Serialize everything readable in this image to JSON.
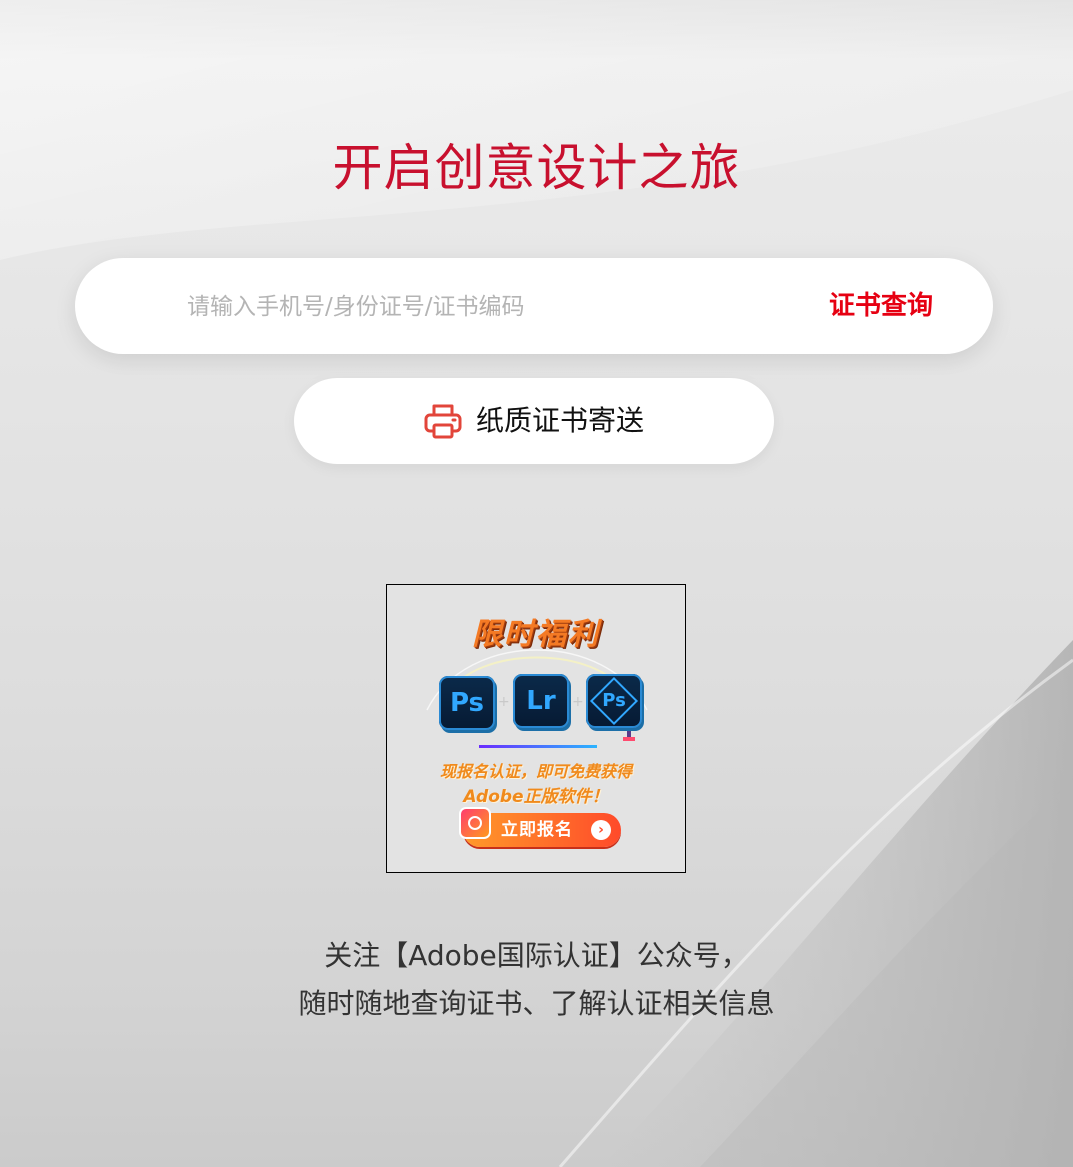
{
  "hero": {
    "title": "开启创意设计之旅"
  },
  "search": {
    "placeholder": "请输入手机号/身份证号/证书编码",
    "value": "",
    "button_label": "证书查询"
  },
  "paper_certificate": {
    "label": "纸质证书寄送",
    "icon": "printer-icon"
  },
  "promo": {
    "title": "限时福利",
    "apps": [
      "Ps",
      "Lr",
      "Ps"
    ],
    "line1": "现报名认证，即可免费获得",
    "line2": "Adobe正版软件！",
    "cta_label": "立即报名",
    "cta_arrow": "›",
    "colors": {
      "title": "#f47a24",
      "cta_start": "#ff9a2a",
      "cta_end": "#ff4a2a",
      "tile_text": "#31a8ff"
    }
  },
  "follow": {
    "line1": "关注【Adobe国际认证】公众号，",
    "line2": "随时随地查询证书、了解认证相关信息"
  },
  "colors": {
    "title": "#c8102e",
    "search_button": "#e60012",
    "body_text": "#333333",
    "icon_red": "#e2453a"
  }
}
